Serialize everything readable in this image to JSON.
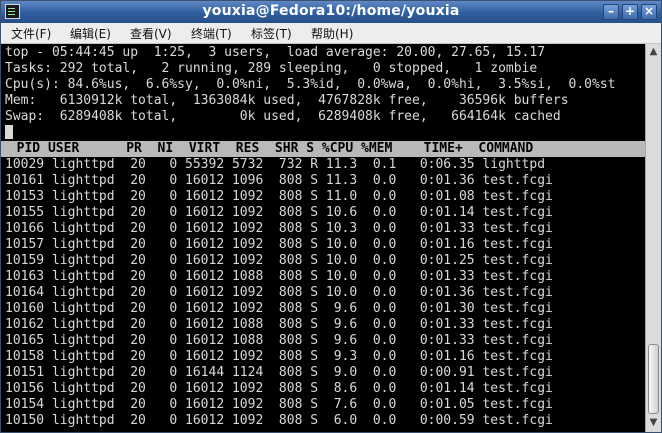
{
  "window": {
    "title": "youxia@Fedora10:/home/youxia",
    "buttons": [
      "–",
      "+",
      "×"
    ]
  },
  "menu": [
    {
      "label": "文件(F)"
    },
    {
      "label": "编辑(E)"
    },
    {
      "label": "查看(V)"
    },
    {
      "label": "终端(T)"
    },
    {
      "label": "标签(T)"
    },
    {
      "label": "帮助(H)"
    }
  ],
  "terminal": {
    "summary": [
      "top - 05:44:45 up  1:25,  3 users,  load average: 20.00, 27.65, 15.17",
      "Tasks: 292 total,   2 running, 289 sleeping,   0 stopped,   1 zombie",
      "Cpu(s): 84.6%us,  6.6%sy,  0.0%ni,  5.3%id,  0.0%wa,  0.0%hi,  3.5%si,  0.0%st",
      "Mem:   6130912k total,  1363084k used,  4767828k free,    36596k buffers",
      "Swap:  6289408k total,        0k used,  6289408k free,   664164k cached"
    ],
    "prompt_line": "",
    "header": "  PID USER      PR  NI  VIRT  RES  SHR S %CPU %MEM    TIME+  COMMAND",
    "processes": [
      "10029 lighttpd  20   0 55392 5732  732 R 11.3  0.1   0:06.35 lighttpd",
      "10161 lighttpd  20   0 16012 1096  808 S 11.3  0.0   0:01.36 test.fcgi",
      "10153 lighttpd  20   0 16012 1092  808 S 11.0  0.0   0:01.08 test.fcgi",
      "10155 lighttpd  20   0 16012 1092  808 S 10.6  0.0   0:01.14 test.fcgi",
      "10166 lighttpd  20   0 16012 1092  808 S 10.3  0.0   0:01.33 test.fcgi",
      "10157 lighttpd  20   0 16012 1092  808 S 10.0  0.0   0:01.16 test.fcgi",
      "10159 lighttpd  20   0 16012 1092  808 S 10.0  0.0   0:01.25 test.fcgi",
      "10163 lighttpd  20   0 16012 1088  808 S 10.0  0.0   0:01.33 test.fcgi",
      "10164 lighttpd  20   0 16012 1092  808 S 10.0  0.0   0:01.36 test.fcgi",
      "10160 lighttpd  20   0 16012 1092  808 S  9.6  0.0   0:01.30 test.fcgi",
      "10162 lighttpd  20   0 16012 1088  808 S  9.6  0.0   0:01.33 test.fcgi",
      "10165 lighttpd  20   0 16012 1088  808 S  9.6  0.0   0:01.33 test.fcgi",
      "10158 lighttpd  20   0 16012 1092  808 S  9.3  0.0   0:01.16 test.fcgi",
      "10151 lighttpd  20   0 16144 1124  808 S  9.0  0.0   0:00.91 test.fcgi",
      "10156 lighttpd  20   0 16012 1092  808 S  8.6  0.0   0:01.14 test.fcgi",
      "10154 lighttpd  20   0 16012 1092  808 S  7.6  0.0   0:01.05 test.fcgi",
      "10150 lighttpd  20   0 16012 1092  808 S  6.0  0.0   0:00.59 test.fcgi"
    ]
  },
  "colors": {
    "titlebar": "#2f5f9f",
    "terminal_bg": "#000000",
    "terminal_fg": "#d9d9d9",
    "header_bg": "#b9b9b9"
  },
  "icons": [
    "terminal-icon",
    "minimize-icon",
    "maximize-icon",
    "close-icon",
    "scroll-up-icon",
    "scroll-down-icon"
  ]
}
